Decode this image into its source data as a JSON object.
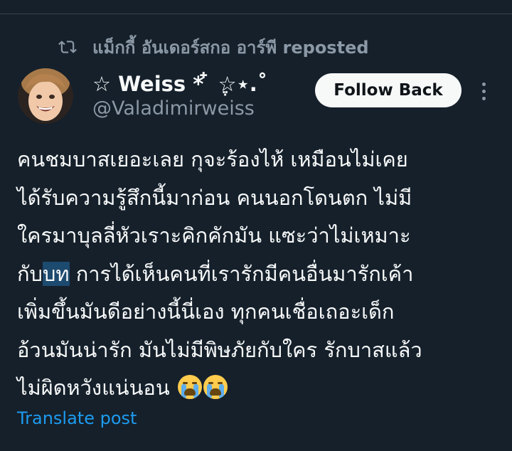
{
  "repost": {
    "icon": "repost-icon",
    "text": "แม็กกี้ อันเดอร์สกอ อาร์พี reposted"
  },
  "author": {
    "display_name": "☆ Weiss * ໋ ֶ☆⋆.˚",
    "handle": "@Valadimirweiss",
    "avatar_icon": "avatar"
  },
  "actions": {
    "follow_label": "Follow Back",
    "more_icon": "more-dots-icon"
  },
  "post": {
    "lines": [
      "คนชมบาสเยอะเลย กุจะร้องไห้ เหมือนไม่เคย",
      "ได้รับความรู้สึกนี้มาก่อน คนนอกโดนตก ไม่มี",
      "ใครมาบุลลี่หัวเราะคิกคักมัน แซะว่าไม่เหมาะ",
      "กับ",
      "บท",
      " การได้เห็นคนที่เรารักมีคนอื่นมารักเค้า",
      "เพิ่มขึ้นมันดีอย่างนี้นี่เอง ทุกคนเชื่อเถอะเด็ก",
      "อ้วนมันน่ารัก มันไม่มีพิษภัยกับใคร รักบาสแล้ว",
      "ไม่ผิดหวังแน่นอน "
    ],
    "emoji": [
      "loudly-crying-face-emoji",
      "loudly-crying-face-emoji"
    ]
  },
  "translate_label": "Translate post",
  "colors": {
    "background": "#15202b",
    "text": "#f7f9f9",
    "muted": "#8b98a5",
    "link": "#1d9bf0",
    "selection": "#1d4a6f"
  }
}
